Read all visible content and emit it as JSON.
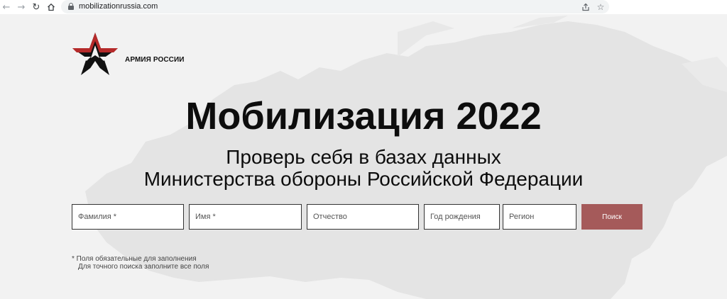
{
  "browser": {
    "url": "mobilizationrussia.com",
    "icons": {
      "back": "arrow-left-icon",
      "forward": "arrow-right-icon",
      "reload": "reload-icon",
      "home": "home-icon",
      "lock": "lock-icon",
      "share": "share-icon",
      "bookmark": "star-icon"
    }
  },
  "logo": {
    "text": "АРМИЯ РОССИИ",
    "colors": {
      "red": "#b52a2a",
      "black": "#111111"
    }
  },
  "hero": {
    "title": "Мобилизация 2022",
    "subtitle_line1": "Проверь себя в базах данных",
    "subtitle_line2": "Министерства обороны Российской Федерации"
  },
  "form": {
    "fields": [
      {
        "placeholder": "Фамилия *",
        "value": ""
      },
      {
        "placeholder": "Имя *",
        "value": ""
      },
      {
        "placeholder": "Отчество",
        "value": ""
      },
      {
        "placeholder": "Год рождения",
        "value": ""
      },
      {
        "placeholder": "Регион",
        "value": ""
      }
    ],
    "search_label": "Поиск",
    "search_color": "#a55a5a"
  },
  "notes": {
    "line1": "* Поля обязательные для заполнения",
    "line2": "Для точного поиска заполните все поля"
  }
}
